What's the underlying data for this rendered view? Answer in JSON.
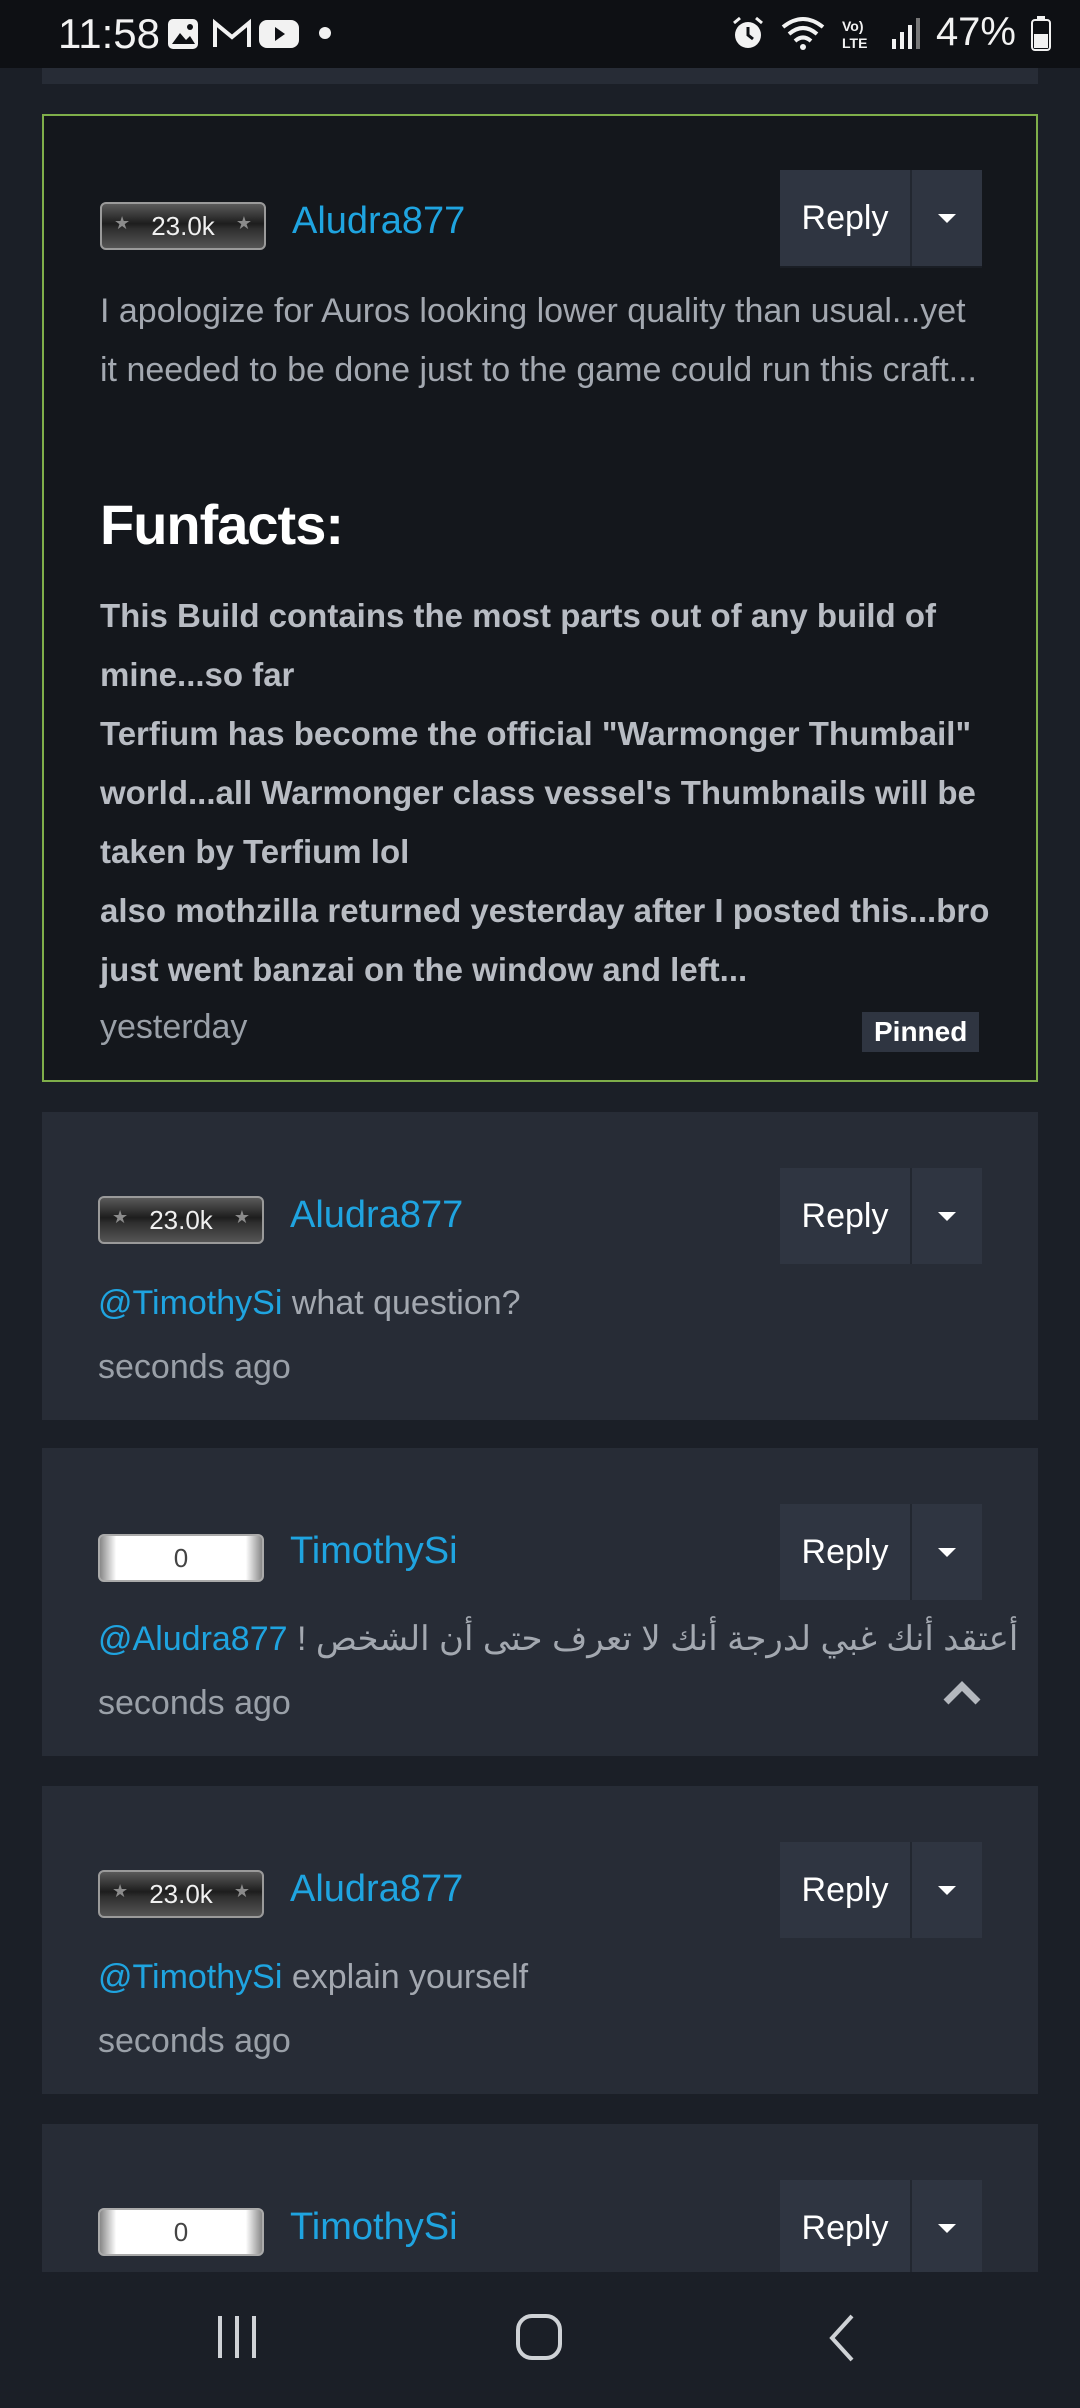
{
  "status_bar": {
    "time": "11:58",
    "battery": "47%",
    "left_icons": [
      "gallery-icon",
      "gmail-icon",
      "youtube-icon",
      "dot-icon"
    ],
    "right_icons": [
      "alarm-icon",
      "wifi-icon",
      "volte-icon",
      "signal-icon",
      "battery-icon"
    ]
  },
  "comments": [
    {
      "pinned": true,
      "badge": "23.0k",
      "user": "Aludra877",
      "reply_label": "Reply",
      "body": "I apologize for Auros looking lower quality than usual...yet it needed to be done just to the game could run this craft...",
      "heading": "Funfacts:",
      "bold_body": "This Build contains the most parts out of any build of mine...so far\nTerfium has become the official \"Warmonger Thumbail\" world...all Warmonger class vessel's Thumbnails will be taken by Terfium lol\nalso mothzilla returned yesterday after I posted this...bro just went banzai on the window and left...",
      "time": "yesterday",
      "pinned_label": "Pinned"
    },
    {
      "badge": "23.0k",
      "user": "Aludra877",
      "reply_label": "Reply",
      "mention": "@TimothySi",
      "text": " what question?",
      "time": "seconds ago"
    },
    {
      "badge": "0",
      "user": "TimothySi",
      "reply_label": "Reply",
      "mention": "@Aludra877",
      "text": "أعتقد أنك غبي لدرجة أنك لا تعرف حتى أن الشخص !",
      "time": "seconds ago"
    },
    {
      "badge": "23.0k",
      "user": "Aludra877",
      "reply_label": "Reply",
      "mention": "@TimothySi",
      "text": " explain yourself",
      "time": "seconds ago"
    },
    {
      "badge": "0",
      "user": "TimothySi",
      "reply_label": "Reply"
    }
  ],
  "nav_bar": {
    "icons": [
      "recent-apps-icon",
      "home-icon",
      "back-icon"
    ]
  }
}
